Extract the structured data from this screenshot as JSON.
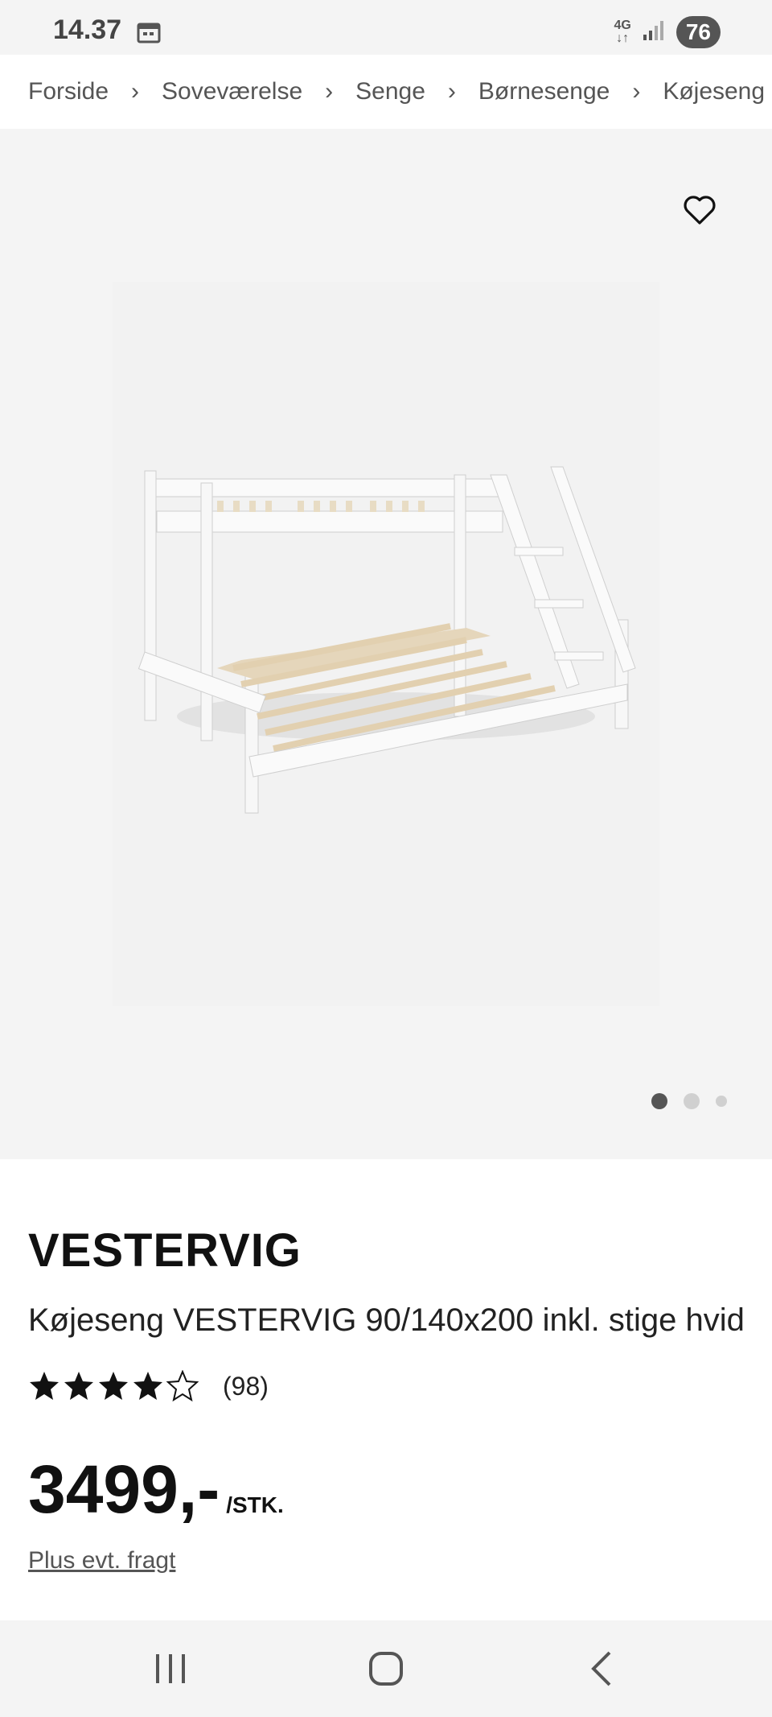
{
  "status": {
    "time": "14.37",
    "network": "4G",
    "battery": "76"
  },
  "breadcrumb": [
    "Forside",
    "Soveværelse",
    "Senge",
    "Børnesenge",
    "Køjeseng"
  ],
  "gallery": {
    "total_images": 3,
    "active_index": 0
  },
  "product": {
    "brand": "VESTERVIG",
    "title": "Køjeseng VESTERVIG 90/140x200 inkl. stige hvid",
    "rating_value": 4.5,
    "rating_max": 5,
    "review_count": "(98)",
    "price": "3499,-",
    "price_unit": "/STK.",
    "shipping_link": "Plus evt. fragt"
  },
  "icons": {
    "favorite": "heart-outline-icon",
    "calendar": "calendar-icon",
    "signal": "signal-icon",
    "nav_recent": "recent-apps-icon",
    "nav_home": "home-icon",
    "nav_back": "back-icon"
  }
}
